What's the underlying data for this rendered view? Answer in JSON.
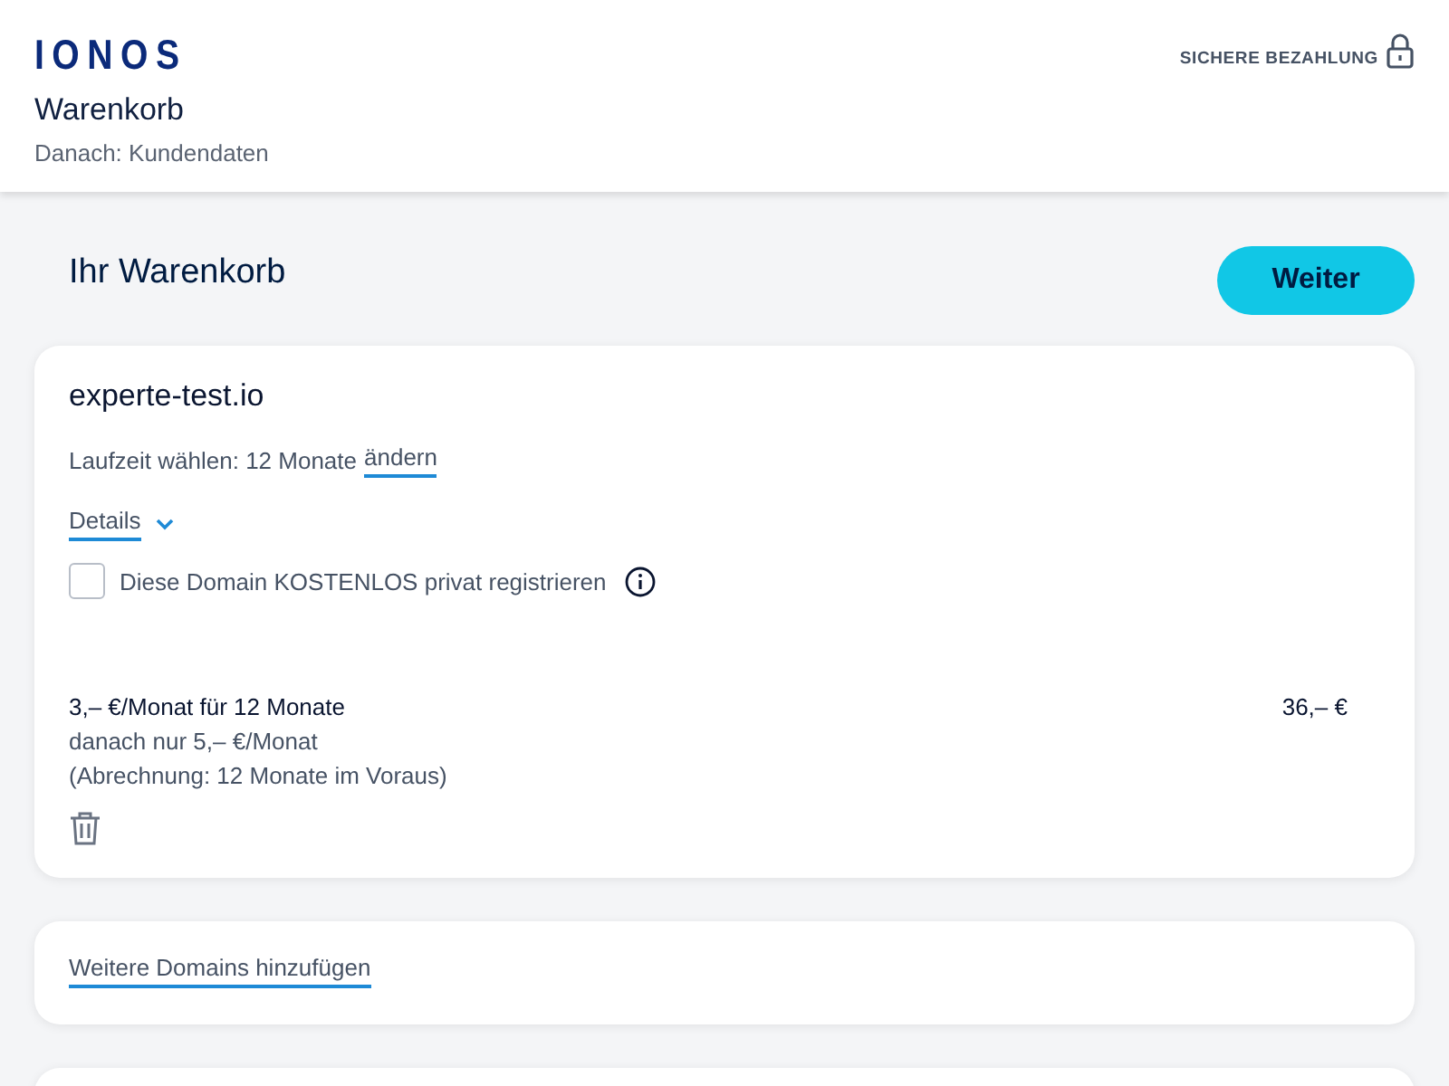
{
  "header": {
    "logo": "IONOS",
    "title": "Warenkorb",
    "next_step": "Danach: Kundendaten",
    "secure_label": "SICHERE BEZAHLUNG"
  },
  "cart": {
    "title": "Ihr Warenkorb",
    "continue_button": "Weiter"
  },
  "item": {
    "domain": "experte-test.io",
    "term_label": "Laufzeit wählen: 12 Monate",
    "term_link": "ändern",
    "details": {
      "label": "Details",
      "expanded": false
    },
    "privacy": {
      "label": "Diese Domain KOSTENLOS privat registrieren",
      "checked": false
    },
    "price_main": "3,– €/Monat für 12 Monate",
    "price_after": "danach nur 5,– €/Monat",
    "billing": "(Abrechnung: 12 Monate im Voraus)",
    "total": "36,– €"
  },
  "add_more": "Weitere Domains hinzufügen"
}
